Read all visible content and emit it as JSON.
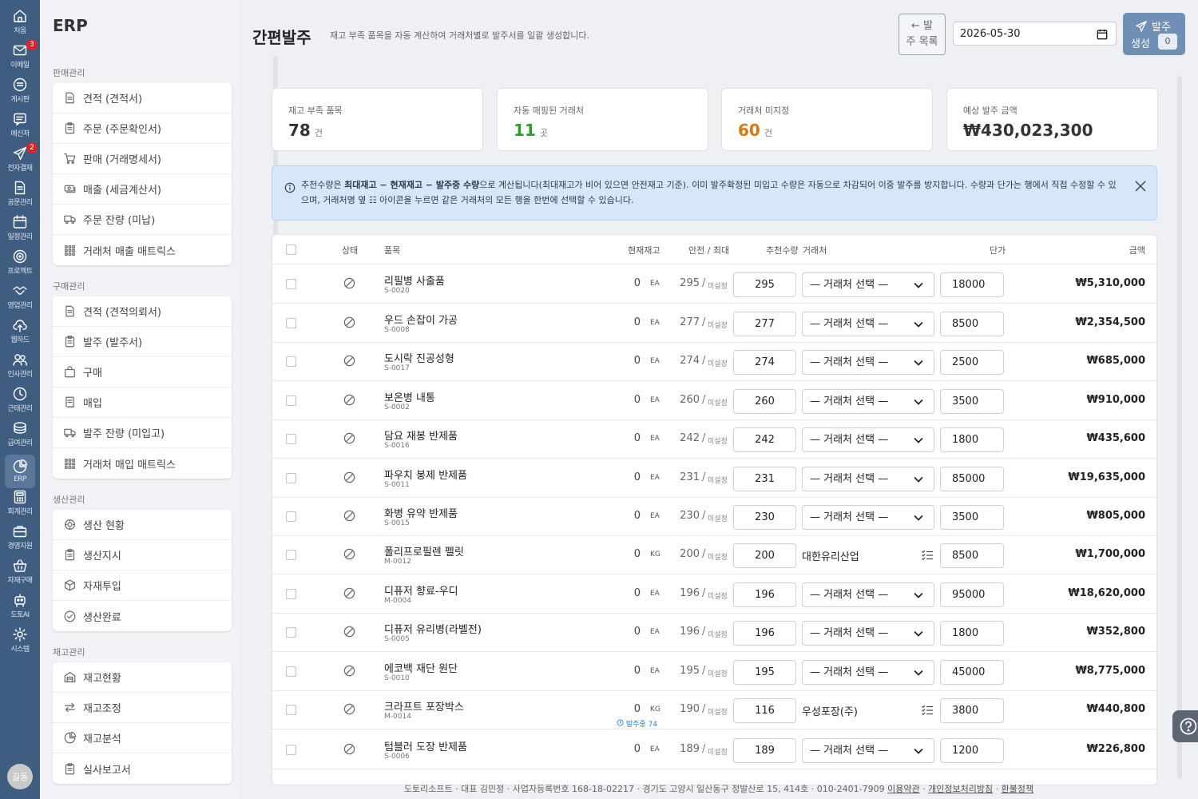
{
  "rail": {
    "items": [
      {
        "label": "처음",
        "icon": "home-icon"
      },
      {
        "label": "이메일",
        "icon": "mail-icon",
        "badge": "3"
      },
      {
        "label": "게시판",
        "icon": "board-icon"
      },
      {
        "label": "메신저",
        "icon": "messenger-icon"
      },
      {
        "label": "전자결재",
        "icon": "approval-icon",
        "badge": "2"
      },
      {
        "label": "공문관리",
        "icon": "document-icon"
      },
      {
        "label": "일정관리",
        "icon": "calendar-icon"
      },
      {
        "label": "프로젝트",
        "icon": "project-icon"
      },
      {
        "label": "영업관리",
        "icon": "handshake-icon"
      },
      {
        "label": "웹하드",
        "icon": "cloud-upload-icon"
      },
      {
        "label": "인사관리",
        "icon": "people-icon"
      },
      {
        "label": "근태관리",
        "icon": "clock-icon"
      },
      {
        "label": "급여관리",
        "icon": "coins-icon"
      },
      {
        "label": "ERP",
        "icon": "pie-chart-icon",
        "active": true
      },
      {
        "label": "회계관리",
        "icon": "calculator-icon"
      },
      {
        "label": "경영지원",
        "icon": "briefcase-icon"
      },
      {
        "label": "자재구매",
        "icon": "basket-icon"
      },
      {
        "label": "도토AI",
        "icon": "robot-icon"
      },
      {
        "label": "시스템",
        "icon": "gear-icon"
      }
    ],
    "avatar": "길동"
  },
  "sidebar": {
    "brand": "ERP",
    "sections": [
      {
        "title": "판매관리",
        "items": [
          {
            "label": "견적 (견적서)",
            "icon": "document-icon"
          },
          {
            "label": "주문 (주문확인서)",
            "icon": "clipboard-icon"
          },
          {
            "label": "판매 (거래명세서)",
            "icon": "cart-icon"
          },
          {
            "label": "매출 (세금계산서)",
            "icon": "cash-stack-icon"
          },
          {
            "label": "주문 잔량 (미납)",
            "icon": "truck-icon"
          },
          {
            "label": "거래처 매출 매트릭스",
            "icon": "grid-icon"
          }
        ]
      },
      {
        "title": "구매관리",
        "items": [
          {
            "label": "견적 (견적의뢰서)",
            "icon": "document-icon"
          },
          {
            "label": "발주 (발주서)",
            "icon": "clipboard-icon"
          },
          {
            "label": "구매",
            "icon": "bag-icon"
          },
          {
            "label": "매입",
            "icon": "receipt-icon"
          },
          {
            "label": "발주 잔량 (미입고)",
            "icon": "truck-icon"
          },
          {
            "label": "거래처 매입 매트릭스",
            "icon": "grid-icon"
          }
        ]
      },
      {
        "title": "생산관리",
        "items": [
          {
            "label": "생산 현황",
            "icon": "gear-wide-icon"
          },
          {
            "label": "생산지시",
            "icon": "clipboard-icon"
          },
          {
            "label": "자재투입",
            "icon": "box-icon"
          },
          {
            "label": "생산완료",
            "icon": "check-circle-icon"
          }
        ]
      },
      {
        "title": "재고관리",
        "items": [
          {
            "label": "재고현황",
            "icon": "warehouse-icon"
          },
          {
            "label": "재고조정",
            "icon": "arrows-icon"
          },
          {
            "label": "재고분석",
            "icon": "pie-chart-icon"
          },
          {
            "label": "실사보고서",
            "icon": "clipboard-icon"
          }
        ]
      }
    ]
  },
  "header": {
    "title": "간편발주",
    "description": "재고 부족 품목을 자동 계산하여 거래처별로 발주서를 일괄 생성합니다.",
    "back_line1": "← 발",
    "back_line2": "주 목록",
    "date": "2026-05-30",
    "generate_line1": "발주",
    "generate_line2": "생성",
    "generate_count": "0"
  },
  "stats": [
    {
      "label": "재고 부족 품목",
      "value": "78",
      "unit": "건",
      "color": "#333333"
    },
    {
      "label": "자동 매핑된 거래처",
      "value": "11",
      "unit": "곳",
      "color": "#2f9a2f"
    },
    {
      "label": "거래처 미지정",
      "value": "60",
      "unit": "건",
      "color": "#d9770f"
    },
    {
      "label": "예상 발주 금액",
      "value": "₩430,023,300",
      "unit": "",
      "color": "#333333"
    }
  ],
  "alert": {
    "part1": "추천수량은 ",
    "bold": "최대재고 − 현재재고 − 발주중 수량",
    "part2": "으로 계산됩니다(최대재고가 비어 있으면 안전재고 기준). 이미 발주확정된 미입고 수량은 자동으로 차감되어 이중 발주를 방지합니다. 수량과 단가는 행에서 직접 수정할 수 있으며, 거래처명 옆 ☷ 아이콘을 누르면 같은 거래처의 모든 행을 한번에 선택할 수 있습니다."
  },
  "table": {
    "headers": {
      "status": "상태",
      "item": "품목",
      "stock": "현재재고",
      "safe_max": "안전 / 최대",
      "qty": "추천수량",
      "vendor": "거래처",
      "price": "단가",
      "amount": "금액"
    },
    "unset_label": "미설정",
    "vendor_placeholder": "— 거래처 선택 —",
    "rows": [
      {
        "name": "리필병 사출품",
        "code": "S-0020",
        "stock": "0",
        "unit": "EA",
        "safe": "295",
        "qty": "295",
        "vendor": "",
        "price": "18000",
        "amount": "₩5,310,000"
      },
      {
        "name": "우드 손잡이 가공",
        "code": "S-0008",
        "stock": "0",
        "unit": "EA",
        "safe": "277",
        "qty": "277",
        "vendor": "",
        "price": "8500",
        "amount": "₩2,354,500"
      },
      {
        "name": "도시락 진공성형",
        "code": "S-0017",
        "stock": "0",
        "unit": "EA",
        "safe": "274",
        "qty": "274",
        "vendor": "",
        "price": "2500",
        "amount": "₩685,000"
      },
      {
        "name": "보온병 내통",
        "code": "S-0002",
        "stock": "0",
        "unit": "EA",
        "safe": "260",
        "qty": "260",
        "vendor": "",
        "price": "3500",
        "amount": "₩910,000"
      },
      {
        "name": "담요 재봉 반제품",
        "code": "S-0016",
        "stock": "0",
        "unit": "EA",
        "safe": "242",
        "qty": "242",
        "vendor": "",
        "price": "1800",
        "amount": "₩435,600"
      },
      {
        "name": "파우치 봉제 반제품",
        "code": "S-0011",
        "stock": "0",
        "unit": "EA",
        "safe": "231",
        "qty": "231",
        "vendor": "",
        "price": "85000",
        "amount": "₩19,635,000"
      },
      {
        "name": "화병 유약 반제품",
        "code": "S-0015",
        "stock": "0",
        "unit": "EA",
        "safe": "230",
        "qty": "230",
        "vendor": "",
        "price": "3500",
        "amount": "₩805,000"
      },
      {
        "name": "폴리프로필렌 펠릿",
        "code": "M-0012",
        "stock": "0",
        "unit": "KG",
        "safe": "200",
        "qty": "200",
        "vendor": "대한유리산업",
        "price": "8500",
        "amount": "₩1,700,000"
      },
      {
        "name": "디퓨저 향료-우디",
        "code": "M-0004",
        "stock": "0",
        "unit": "EA",
        "safe": "196",
        "qty": "196",
        "vendor": "",
        "price": "95000",
        "amount": "₩18,620,000"
      },
      {
        "name": "디퓨저 유리병(라벨전)",
        "code": "S-0005",
        "stock": "0",
        "unit": "EA",
        "safe": "196",
        "qty": "196",
        "vendor": "",
        "price": "1800",
        "amount": "₩352,800"
      },
      {
        "name": "에코백 재단 원단",
        "code": "S-0010",
        "stock": "0",
        "unit": "EA",
        "safe": "195",
        "qty": "195",
        "vendor": "",
        "price": "45000",
        "amount": "₩8,775,000"
      },
      {
        "name": "크라프트 포장박스",
        "code": "M-0014",
        "stock": "0",
        "unit": "KG",
        "safe": "190",
        "qty": "116",
        "vendor": "우성포장(주)",
        "price": "3800",
        "amount": "₩440,800",
        "ordering": "발주중 74"
      },
      {
        "name": "텀블러 도장 반제품",
        "code": "S-0006",
        "stock": "0",
        "unit": "EA",
        "safe": "189",
        "qty": "189",
        "vendor": "",
        "price": "1200",
        "amount": "₩226,800"
      }
    ]
  },
  "footer": {
    "text": "도토리소프트 · 대표 김민정 · 사업자등록번호 168-18-02217 · 경기도 고양시 일산동구 정발산로 15, 414호 · 010-2401-7909 ",
    "link1": "이용약관",
    "link2": "개인정보처리방침",
    "link3": "환불정책",
    "sep": " · "
  }
}
